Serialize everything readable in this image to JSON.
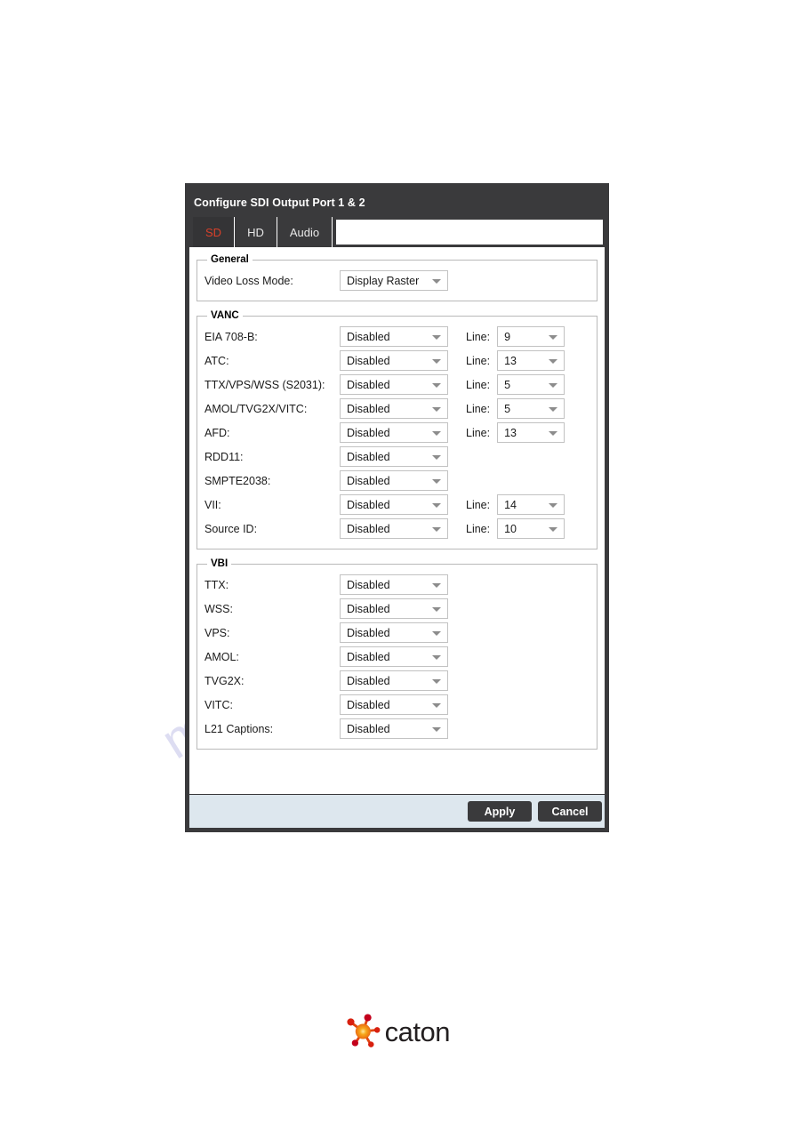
{
  "dialog": {
    "title": "Configure SDI Output Port 1 & 2",
    "tabs": [
      {
        "label": "SD",
        "active": true
      },
      {
        "label": "HD",
        "active": false
      },
      {
        "label": "Audio",
        "active": false
      }
    ],
    "active_tab_color": "#d8402a",
    "titlebar_color": "#3a3a3c",
    "footer_color": "#dde7ee"
  },
  "general": {
    "legend": "General",
    "rows": [
      {
        "label": "Video Loss Mode:",
        "value": "Display Raster"
      }
    ]
  },
  "vanc": {
    "legend": "VANC",
    "line_label": "Line:",
    "rows": [
      {
        "label": "EIA 708-B:",
        "value": "Disabled",
        "has_line": true,
        "line": "9"
      },
      {
        "label": "ATC:",
        "value": "Disabled",
        "has_line": true,
        "line": "13"
      },
      {
        "label": "TTX/VPS/WSS (S2031):",
        "value": "Disabled",
        "has_line": true,
        "line": "5"
      },
      {
        "label": "AMOL/TVG2X/VITC:",
        "value": "Disabled",
        "has_line": true,
        "line": "5"
      },
      {
        "label": "AFD:",
        "value": "Disabled",
        "has_line": true,
        "line": "13"
      },
      {
        "label": "RDD11:",
        "value": "Disabled",
        "has_line": false,
        "line": ""
      },
      {
        "label": "SMPTE2038:",
        "value": "Disabled",
        "has_line": false,
        "line": ""
      },
      {
        "label": "VII:",
        "value": "Disabled",
        "has_line": true,
        "line": "14"
      },
      {
        "label": "Source ID:",
        "value": "Disabled",
        "has_line": true,
        "line": "10"
      }
    ]
  },
  "vbi": {
    "legend": "VBI",
    "rows": [
      {
        "label": "TTX:",
        "value": "Disabled"
      },
      {
        "label": "WSS:",
        "value": "Disabled"
      },
      {
        "label": "VPS:",
        "value": "Disabled"
      },
      {
        "label": "AMOL:",
        "value": "Disabled"
      },
      {
        "label": "TVG2X:",
        "value": "Disabled"
      },
      {
        "label": "VITC:",
        "value": "Disabled"
      },
      {
        "label": "L21 Captions:",
        "value": "Disabled"
      }
    ]
  },
  "footer": {
    "apply_label": "Apply",
    "cancel_label": "Cancel"
  },
  "branding": {
    "name": "caton",
    "logo_colors": [
      "#f5a623",
      "#e8410f",
      "#c9001f"
    ]
  },
  "watermark": {
    "line1": "manualsarchive.com"
  }
}
